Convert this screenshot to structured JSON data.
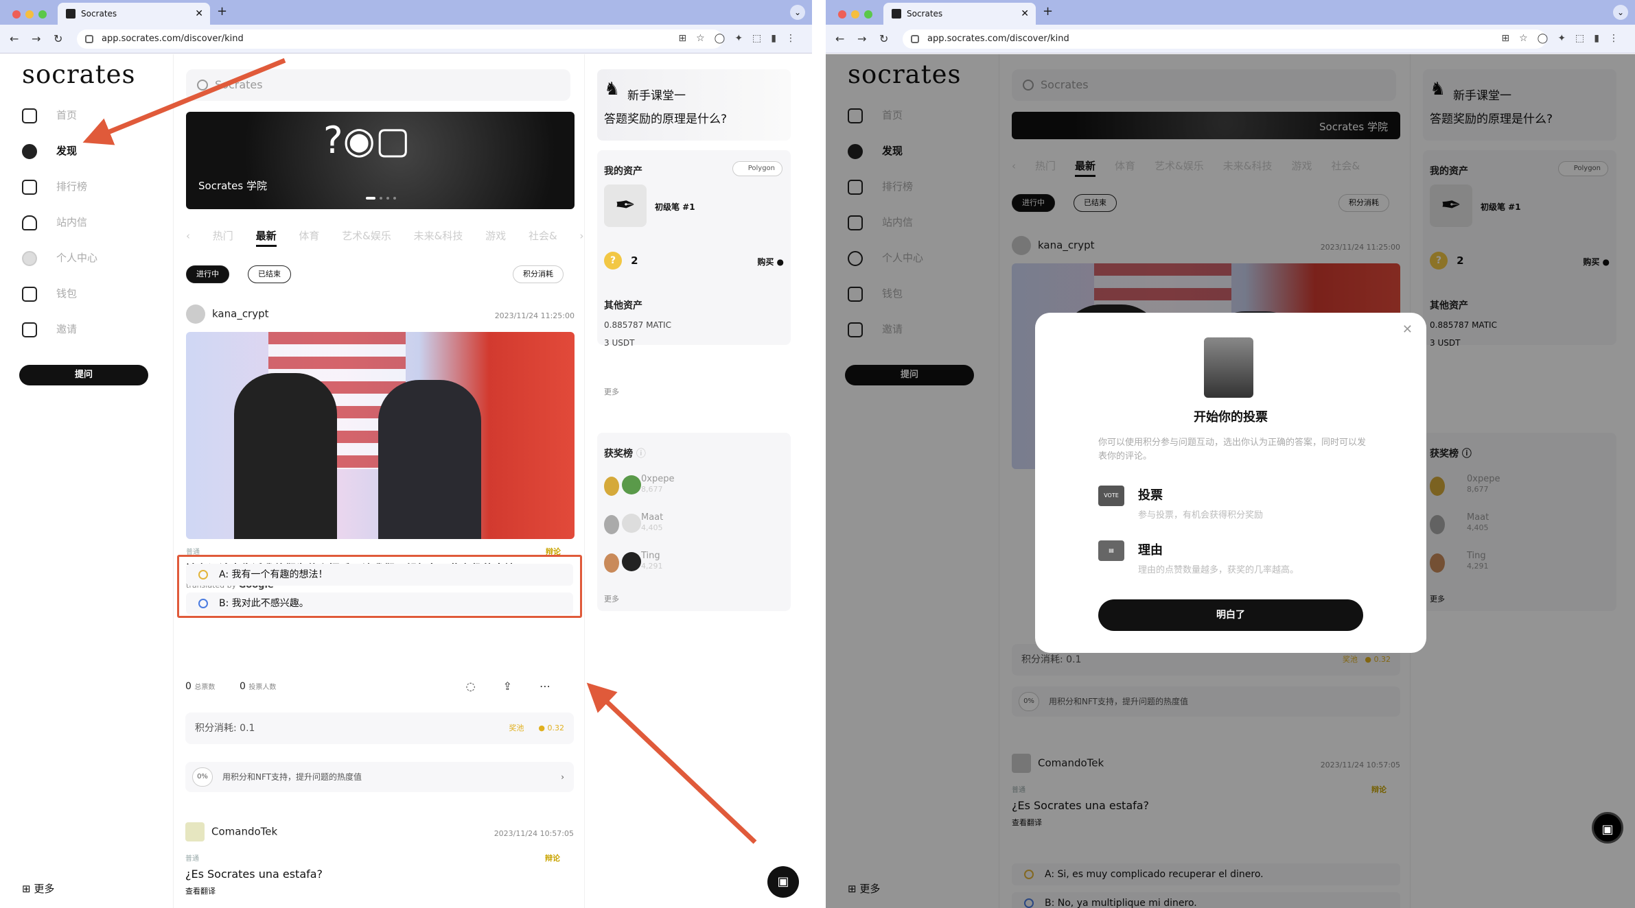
{
  "browser": {
    "tab_title": "Socrates",
    "url": "app.socrates.com/discover/kind"
  },
  "app": {
    "logo": "socrates",
    "sidebar": [
      {
        "label": "首页",
        "icon": "home-icon",
        "active": false
      },
      {
        "label": "发现",
        "icon": "discover-icon",
        "active": true
      },
      {
        "label": "排行榜",
        "icon": "chart-icon",
        "active": false
      },
      {
        "label": "站内信",
        "icon": "bell-icon",
        "active": false
      },
      {
        "label": "个人中心",
        "icon": "user-icon",
        "active": false
      },
      {
        "label": "钱包",
        "icon": "wallet-icon",
        "active": false
      },
      {
        "label": "邀请",
        "icon": "invite-icon",
        "active": false
      }
    ],
    "ask_button": "提问",
    "more": "更多",
    "search_placeholder": "Socrates",
    "banner_title": "Socrates 学院",
    "categories": [
      "热门",
      "最新",
      "体育",
      "艺术&娱乐",
      "未来&科技",
      "游戏",
      "社会&"
    ],
    "filter": {
      "ongoing": "进行中",
      "ended": "已结束",
      "sort": "积分消耗"
    },
    "post1": {
      "author": "kana_crypt",
      "date": "2023/11/24 11:25:00",
      "tag": "普通",
      "type": "辩论",
      "question": "请在评论中告诉我他们为什么握手。让我们一起想象一些有趣的事情吧！",
      "translated_by": "translated by",
      "google": "Google",
      "option_a": "A:  我有一个有趣的想法！",
      "option_b": "B:  我对此不感兴趣。",
      "total_votes": "0",
      "total_votes_label": "总票数",
      "voters": "0",
      "voters_label": "投票人数",
      "cost": "积分消耗: 0.1",
      "reward_label": "奖池",
      "reward": "0.32",
      "heat_pct": "0%",
      "heat_text": "用积分和NFT支持，提升问题的热度值"
    },
    "post2": {
      "author": "ComandoTek",
      "date": "2023/11/24 10:57:05",
      "tag": "普通",
      "type": "辩论",
      "question": "¿Es Socrates una estafa?",
      "translate": "查看翻译",
      "option_a": "A:  Si, es muy complicado recuperar el dinero.",
      "option_b": "B:  No, ya multiplique mi dinero."
    },
    "right": {
      "course_title": "新手课堂一",
      "course_sub": "答题奖励的原理是什么?",
      "assets_title": "我的资产",
      "network": "Polygon",
      "nft_name": "初级笔 #1",
      "coins": "2",
      "buy": "购买",
      "other_title": "其他资产",
      "matic": "0.885787 MATIC",
      "usdt": "3 USDT",
      "more": "更多",
      "leaderboard_title": "获奖榜",
      "leaders": [
        {
          "name": "0xpepe",
          "score": "8,677"
        },
        {
          "name": "Maat",
          "score": "4,405"
        },
        {
          "name": "Ting",
          "score": "4,291"
        }
      ]
    },
    "modal": {
      "title": "开始你的投票",
      "desc": "你可以使用积分参与问题互动，选出你认为正确的答案，同时可以发表你的评论。",
      "vote_title": "投票",
      "vote_desc": "参与投票，有机会获得积分奖励",
      "reason_title": "理由",
      "reason_desc": "理由的点赞数量越多，获奖的几率越高。",
      "ok": "明白了",
      "vote_badge": "VOTE"
    }
  },
  "colors": {
    "arrow": "#e05a3a",
    "coin": "#f2c744",
    "chrome": "#aab8e8"
  }
}
